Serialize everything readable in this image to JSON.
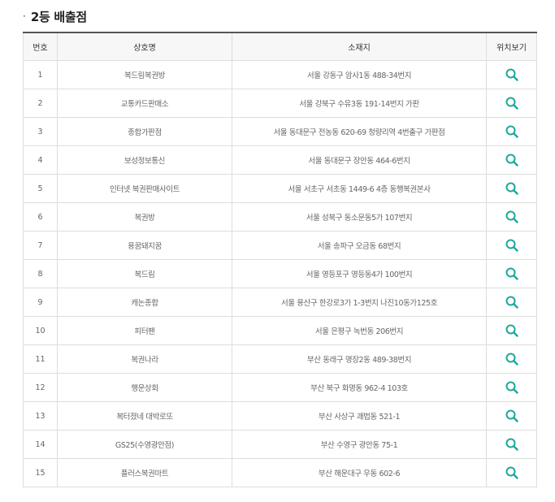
{
  "section": {
    "bullet": "·",
    "title": "2등 배출점"
  },
  "table": {
    "headers": [
      "번호",
      "상호명",
      "소재지",
      "위치보기"
    ],
    "icon": "search-icon",
    "icon_color": "#1aa89a",
    "rows": [
      {
        "no": "1",
        "name": "복드림복권방",
        "address": "서울 강동구 암사1동 488-34번지"
      },
      {
        "no": "2",
        "name": "교통카드판매소",
        "address": "서울 강북구 수유3동 191-14번지 가판"
      },
      {
        "no": "3",
        "name": "종합가판점",
        "address": "서울 동대문구 전농동 620-69 청량리역 4번출구 가판점"
      },
      {
        "no": "4",
        "name": "보성정보통신",
        "address": "서울 동대문구 장안동 464-6번지"
      },
      {
        "no": "5",
        "name": "인터넷 복권판매사이트",
        "address": "서울 서초구 서초동 1449-6 4층 동행복권본사"
      },
      {
        "no": "6",
        "name": "복권방",
        "address": "서울 성북구 동소문동5가 107번지"
      },
      {
        "no": "7",
        "name": "용꿈돼지꿈",
        "address": "서울 송파구 오금동 68번지"
      },
      {
        "no": "8",
        "name": "복드림",
        "address": "서울 영등포구 영등동4가 100번지"
      },
      {
        "no": "9",
        "name": "캐논종합",
        "address": "서울 용산구 한강로3가 1-3번지 나진10동가125호"
      },
      {
        "no": "10",
        "name": "피터팬",
        "address": "서울 은평구 녹번동 206번지"
      },
      {
        "no": "11",
        "name": "복권나라",
        "address": "부산 동래구 명장2동 489-38번지"
      },
      {
        "no": "12",
        "name": "행운상회",
        "address": "부산 북구 화명동 962-4 103호"
      },
      {
        "no": "13",
        "name": "복터졌네 대박로또",
        "address": "부산 사상구 괘법동 521-1"
      },
      {
        "no": "14",
        "name": "GS25(수영광안점)",
        "address": "부산 수영구 광안동 75-1"
      },
      {
        "no": "15",
        "name": "플러스복권마트",
        "address": "부산 해운대구 우동 602-6"
      }
    ]
  }
}
